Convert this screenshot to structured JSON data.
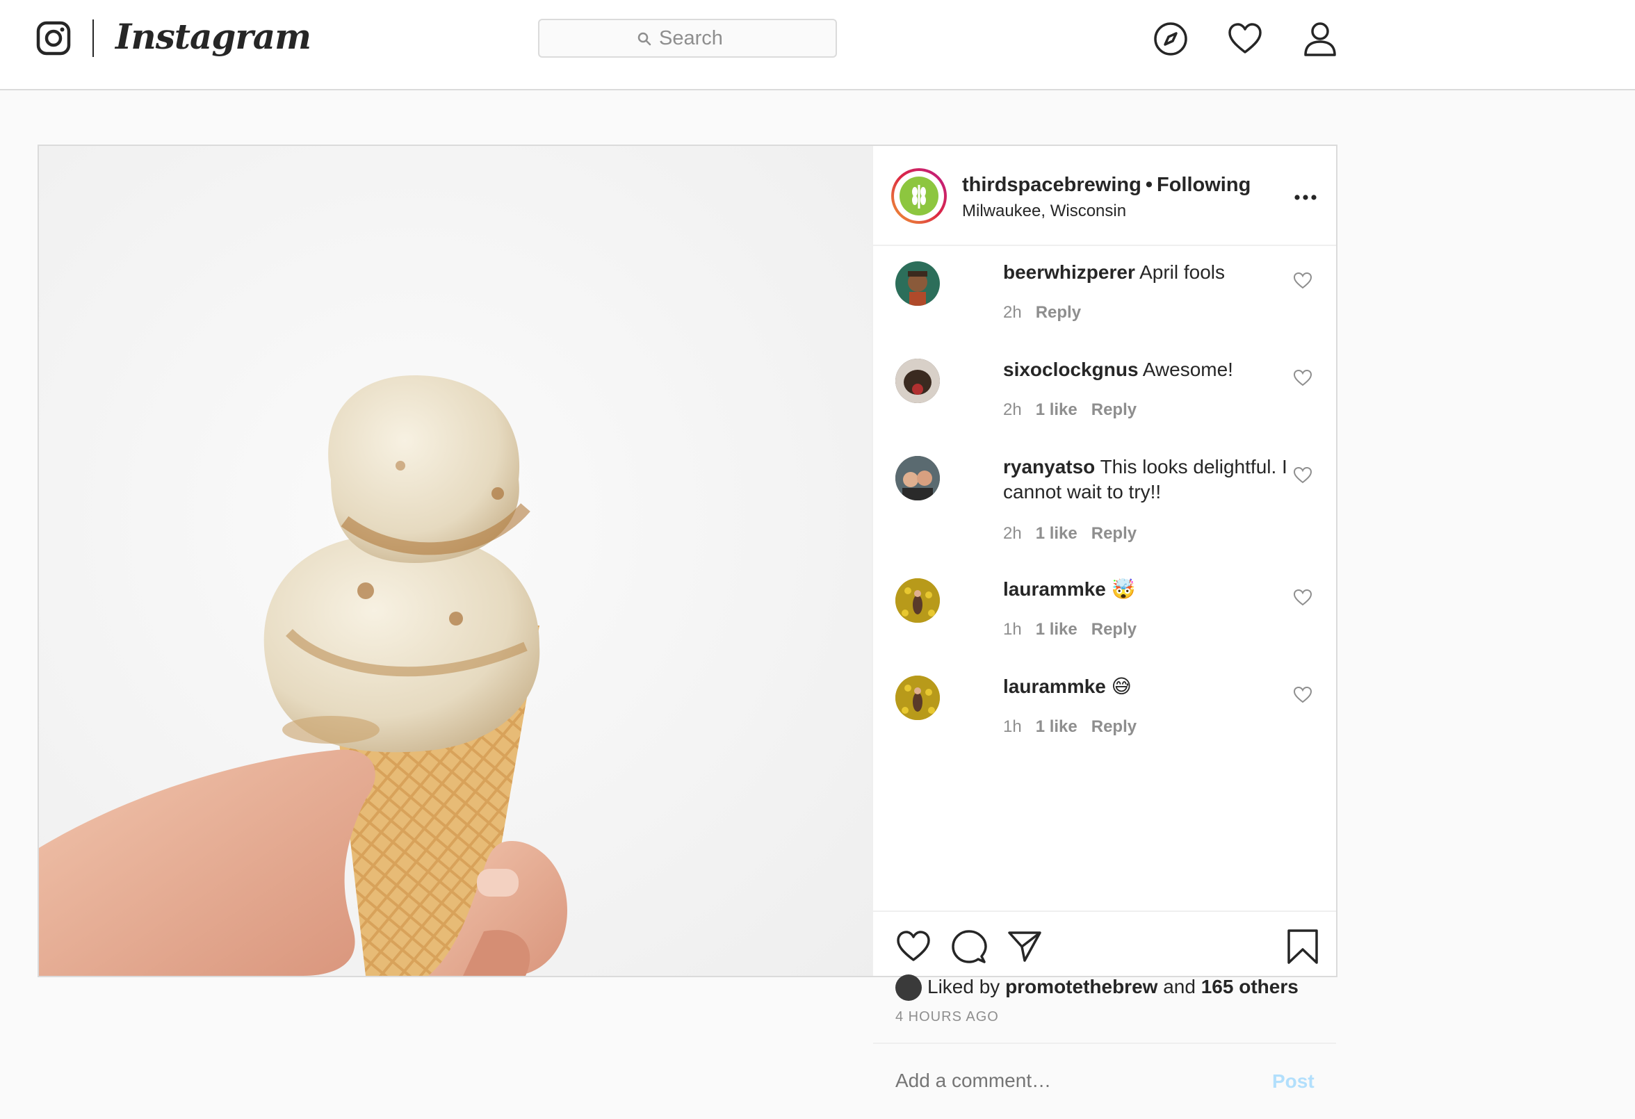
{
  "brand": {
    "wordmark": "Instagram"
  },
  "search": {
    "placeholder": "Search"
  },
  "nav": {
    "icons": [
      "compass-icon",
      "heart-icon",
      "profile-icon"
    ]
  },
  "post": {
    "username": "thirdspacebrewing",
    "separator": "•",
    "follow_status": "Following",
    "location": "Milwaukee, Wisconsin",
    "comments": [
      {
        "user": "beerwhizperer",
        "text": "April fools",
        "time": "2h",
        "likes": "",
        "reply": "Reply"
      },
      {
        "user": "sixoclockgnus",
        "text": "Awesome!",
        "time": "2h",
        "likes": "1 like",
        "reply": "Reply"
      },
      {
        "user": "ryanyatso",
        "text": "This looks delightful. I cannot wait to try!!",
        "time": "2h",
        "likes": "1 like",
        "reply": "Reply"
      },
      {
        "user": "laurammke",
        "text": "🤯",
        "time": "1h",
        "likes": "1 like",
        "reply": "Reply"
      },
      {
        "user": "laurammke",
        "text": "😅",
        "time": "1h",
        "likes": "1 like",
        "reply": "Reply"
      }
    ],
    "liked_by_prefix": "Liked by",
    "liked_by_user": "promotethebrew",
    "liked_by_and": "and",
    "liked_by_others": "165 others",
    "timestamp": "4 HOURS AGO",
    "comment_placeholder": "Add a comment…",
    "post_button": "Post"
  },
  "colors": {
    "accent": "#0095f6",
    "post_disabled": "#b2dffc",
    "meta_gray": "#8e8e8e",
    "border": "#dbdbdb"
  }
}
